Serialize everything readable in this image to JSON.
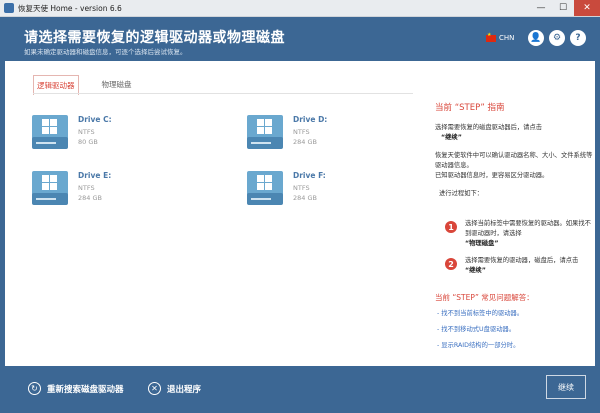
{
  "window": {
    "title": "恢复天使 Home - version 6.6"
  },
  "header": {
    "heading": "请选择需要恢复的逻辑驱动器或物理磁盘",
    "subtitle": "如果未确定驱动器和磁盘信息，可逐个选择后尝试恢复。",
    "language": "CHN"
  },
  "tabs": [
    {
      "label": "逻辑驱动器",
      "active": true
    },
    {
      "label": "物理磁盘",
      "active": false
    }
  ],
  "drives": [
    {
      "name": "Drive C:",
      "fs": "NTFS",
      "size": "80 GB"
    },
    {
      "name": "Drive D:",
      "fs": "NTFS",
      "size": "284 GB"
    },
    {
      "name": "Drive E:",
      "fs": "NTFS",
      "size": "284 GB"
    },
    {
      "name": "Drive F:",
      "fs": "NTFS",
      "size": "284 GB"
    }
  ],
  "sidebar": {
    "title": "当前 “STEP” 指南",
    "p1": "选择需要恢复的磁盘驱动器后，请点击",
    "p1b": "“继续”",
    "p2": "恢复天使软件中可以确认驱动器名称、大小、文件系统等驱动器信息。",
    "p3": "已知驱动器信息时，更容易区分驱动器。",
    "p4": "进行过程如下：",
    "step1_num": "1",
    "step1": "选择当前标签中需要恢复的驱动器。如果找不到驱动器时，请选择",
    "step1b": "“物理磁盘”",
    "step2_num": "2",
    "step2": "选择需要恢复的驱动器，磁盘后，请点击",
    "step2b": "“继续”",
    "faq_title": "当前 “STEP” 常见问题解答：",
    "faq": [
      "- 找不到当前标签中的驱动器。",
      "- 找不到移动式U盘驱动器。",
      "- 显示RAID结构的一部分时。"
    ]
  },
  "footer": {
    "rescan": "重新搜索磁盘驱动器",
    "exit": "退出程序",
    "continue": "继续"
  },
  "colors": {
    "accent": "#3c6794",
    "red": "#d9463a",
    "link": "#3a6fc0"
  }
}
